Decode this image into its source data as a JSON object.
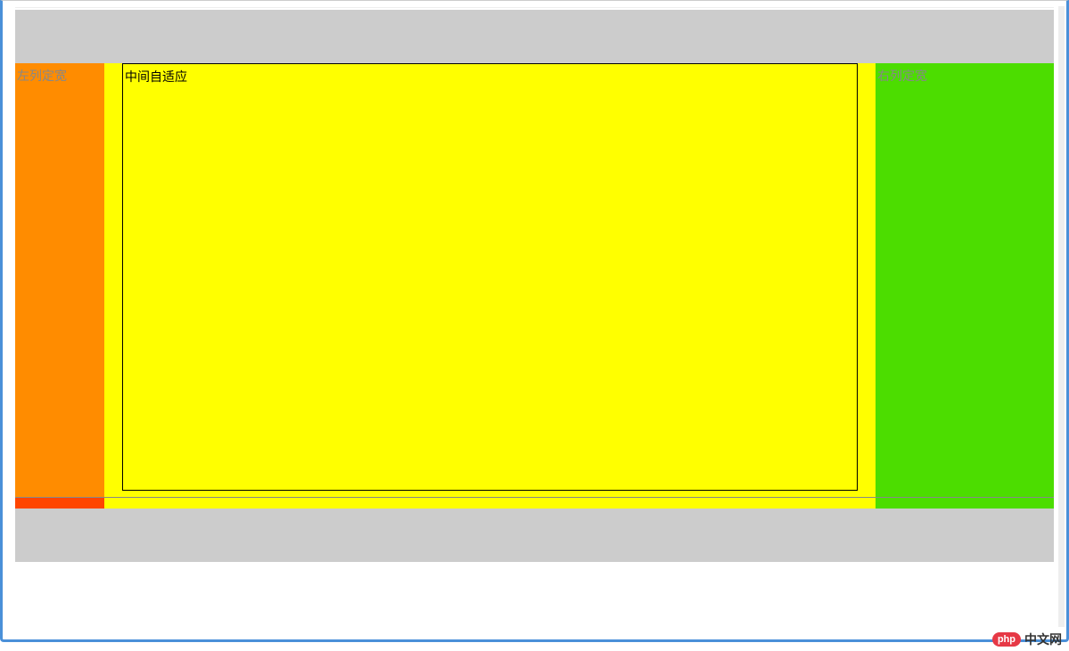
{
  "layout": {
    "left_label": "左列定宽",
    "center_label": "中间自适应",
    "right_label": "右列定宽"
  },
  "watermark": {
    "badge": "php",
    "text": "中文网"
  },
  "colors": {
    "header_bg": "#cccccc",
    "left_bg": "#ff8c00",
    "center_bg": "#ffff00",
    "right_bg": "#4cdd00",
    "footer_bg": "#cccccc"
  }
}
